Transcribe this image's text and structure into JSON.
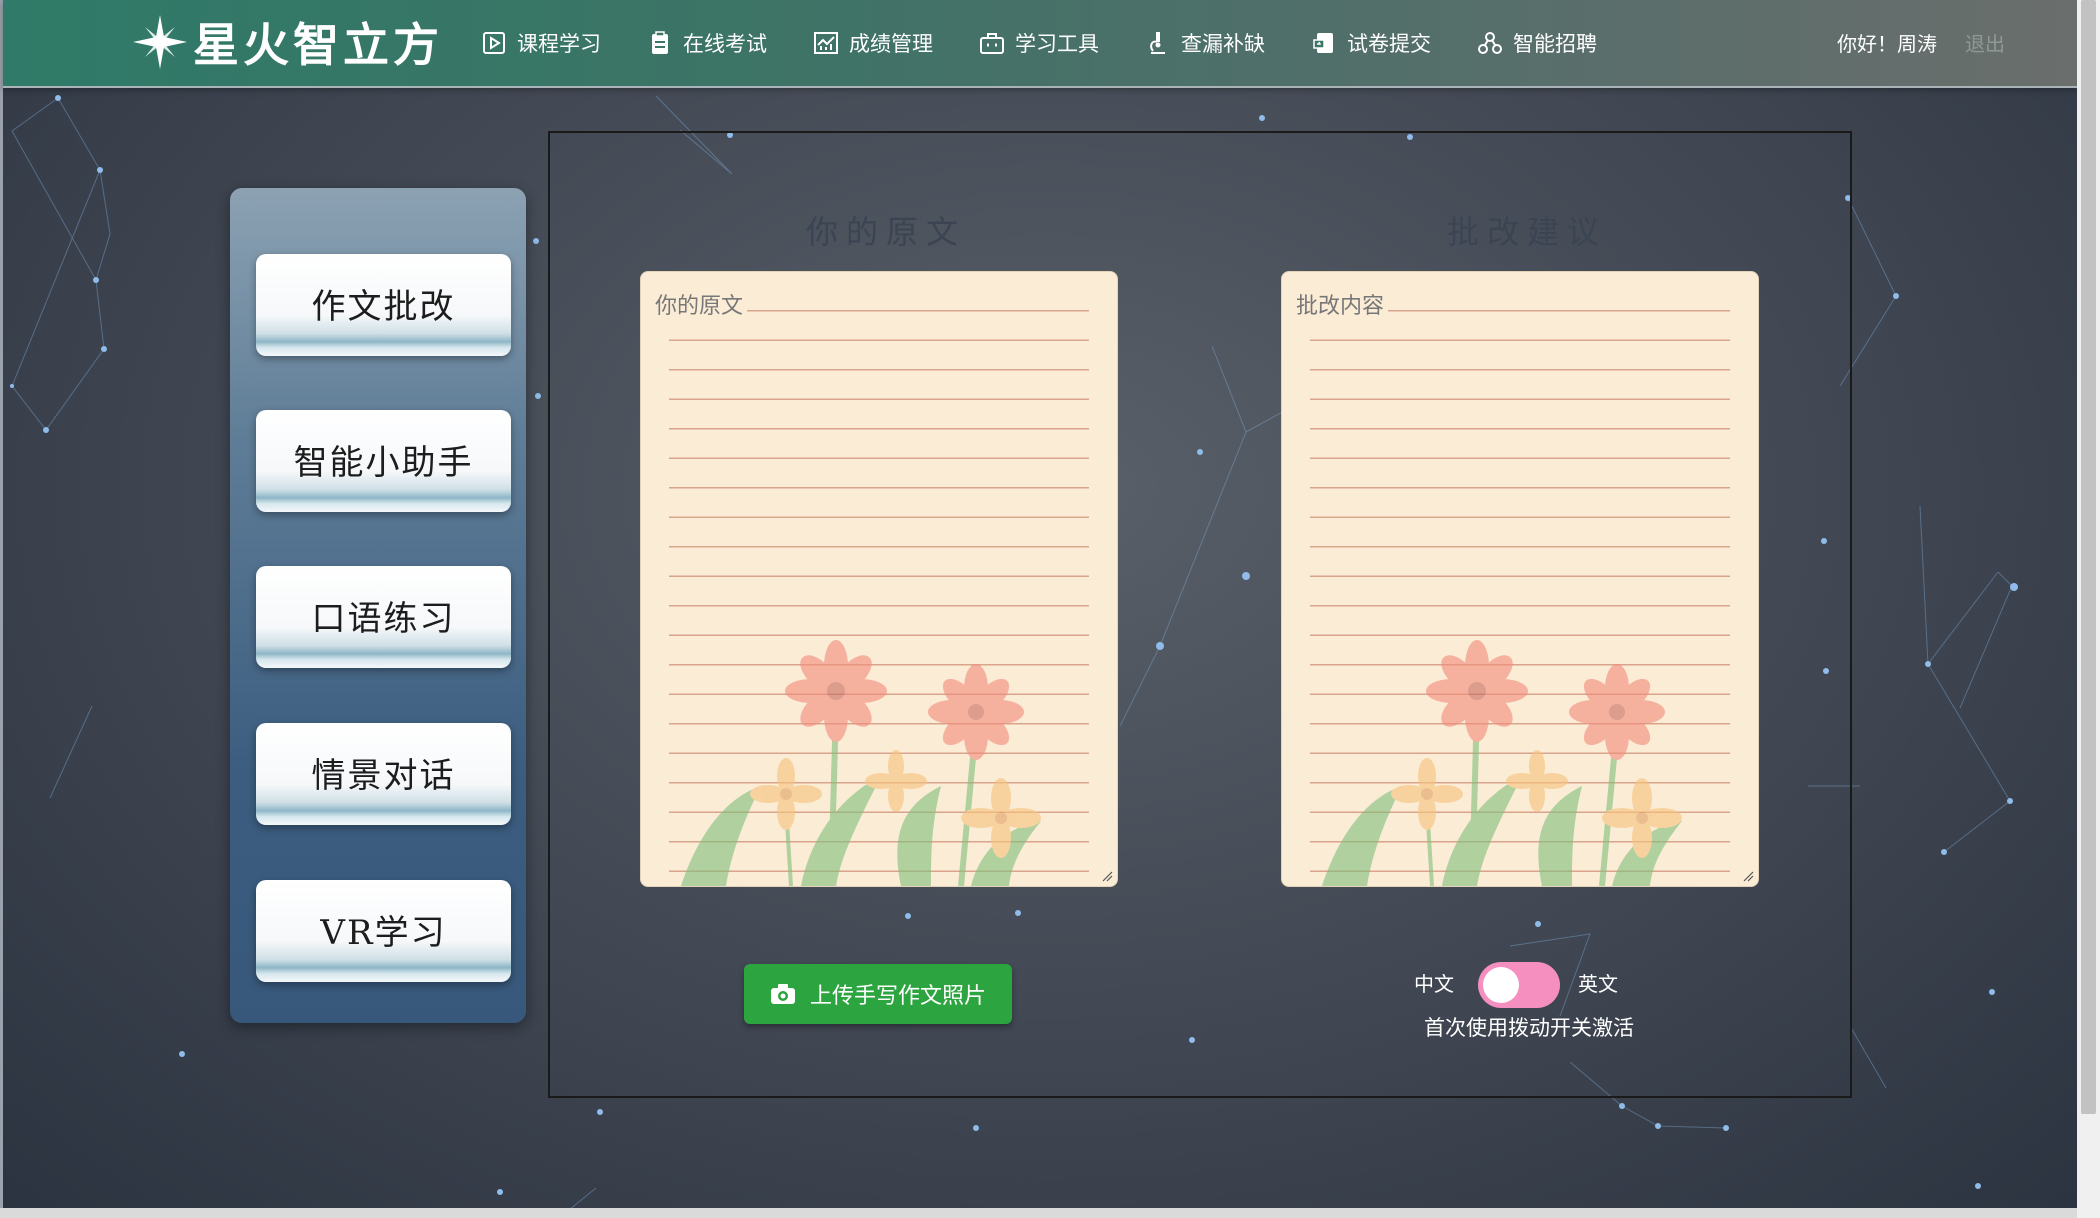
{
  "header": {
    "logo_text": "星火智立方",
    "nav": [
      {
        "label": "课程学习",
        "icon": "play-doc-icon"
      },
      {
        "label": "在线考试",
        "icon": "clipboard-icon"
      },
      {
        "label": "成绩管理",
        "icon": "chart-icon"
      },
      {
        "label": "学习工具",
        "icon": "toolbox-icon"
      },
      {
        "label": "查漏补缺",
        "icon": "microscope-icon"
      },
      {
        "label": "试卷提交",
        "icon": "submit-doc-icon"
      },
      {
        "label": "智能招聘",
        "icon": "network-icon"
      }
    ],
    "greeting": "你好！周涛",
    "logout": "退出"
  },
  "sidebar": {
    "items": [
      {
        "label": "作文批改"
      },
      {
        "label": "智能小助手"
      },
      {
        "label": "口语练习"
      },
      {
        "label": "情景对话"
      },
      {
        "label": "VR学习"
      }
    ]
  },
  "main": {
    "original_title": "你的原文",
    "original_placeholder": "你的原文",
    "suggest_title": "批改建议",
    "suggest_placeholder": "批改内容",
    "upload_label": "上传手写作文照片",
    "lang_zh": "中文",
    "lang_en": "英文",
    "toggle_on": false,
    "hint": "首次使用拨动开关激活"
  },
  "colors": {
    "header_start": "#2f7a68",
    "upload_green": "#2ca43f",
    "toggle_pink": "#f48fc0",
    "paper": "#fbecd6"
  }
}
